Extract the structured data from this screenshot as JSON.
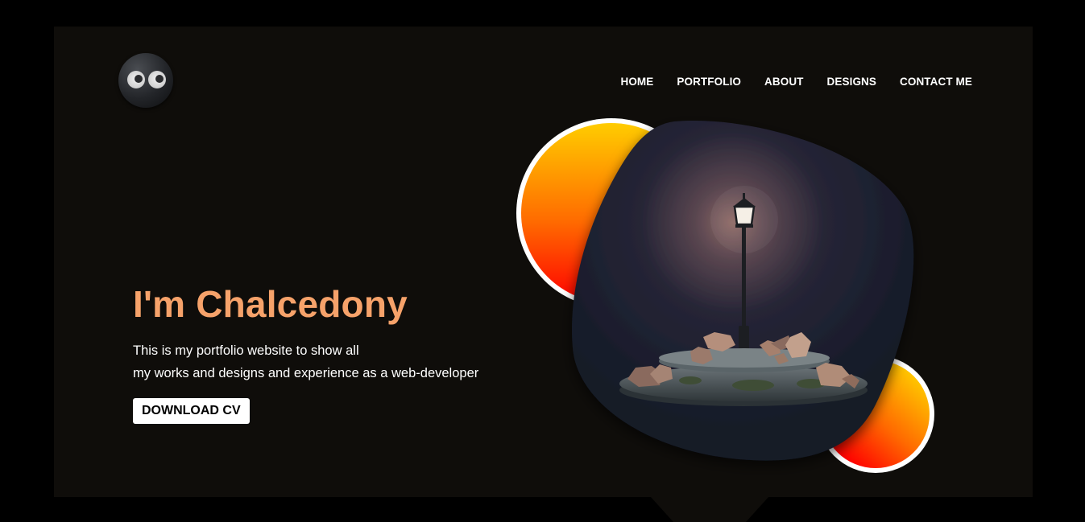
{
  "nav": {
    "items": [
      {
        "label": "HOME"
      },
      {
        "label": "PORTFOLIO"
      },
      {
        "label": "ABOUT"
      },
      {
        "label": "DESIGNS"
      },
      {
        "label": "CONTACT ME"
      }
    ]
  },
  "hero": {
    "title": "I'm Chalcedony",
    "description_line1": "This is my portfolio website to show all",
    "description_line2": "my works and designs and experience as a web-developer",
    "cv_button_label": "DOWNLOAD CV"
  },
  "icons": {
    "logo": "cartoon-eyes-logo-icon",
    "illustration": "street-lamp-on-rock-island-illustration"
  },
  "colors": {
    "page_background": "#000000",
    "panel_background": "#0f0d0a",
    "title_accent": "#f6a26a",
    "gradient_top": "#ffcc00",
    "gradient_bottom": "#ff0000",
    "blob_dark": "#151a26"
  }
}
